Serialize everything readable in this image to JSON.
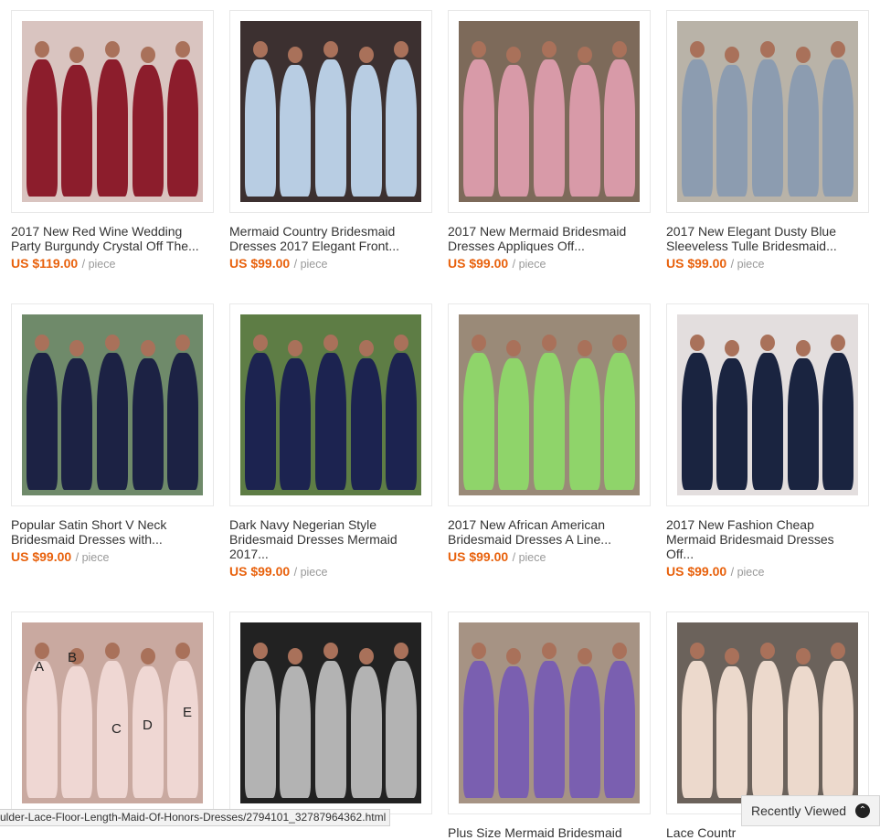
{
  "products": [
    {
      "title": "2017 New Red Wine Wedding\nParty Burgundy Crystal Off The...",
      "price": "US $119.00",
      "unit": "/ piece",
      "bg": "#d9c4c0",
      "dress": "#8c1d2c"
    },
    {
      "title": "Mermaid Country Bridesmaid\nDresses 2017 Elegant Front...",
      "price": "US $99.00",
      "unit": "/ piece",
      "bg": "#3c3030",
      "dress": "#b8cde3"
    },
    {
      "title": "2017 New Mermaid Bridesmaid\nDresses Appliques Off...",
      "price": "US $99.00",
      "unit": "/ piece",
      "bg": "#7d6a5a",
      "dress": "#d89aa8"
    },
    {
      "title": "2017 New Elegant Dusty Blue\nSleeveless Tulle Bridesmaid...",
      "price": "US $99.00",
      "unit": "/ piece",
      "bg": "#b9b3a8",
      "dress": "#8c9cb0"
    },
    {
      "title": "Popular Satin Short V Neck\nBridesmaid Dresses with...",
      "price": "US $99.00",
      "unit": "/ piece",
      "bg": "#6f8a6a",
      "dress": "#1c2244"
    },
    {
      "title": "Dark Navy Negerian Style\nBridesmaid Dresses Mermaid\n2017...",
      "price": "US $99.00",
      "unit": "/ piece",
      "bg": "#5e7d45",
      "dress": "#1c2350"
    },
    {
      "title": "2017 New African American\nBridesmaid Dresses A Line...",
      "price": "US $99.00",
      "unit": "/ piece",
      "bg": "#9a8a78",
      "dress": "#8fd46a"
    },
    {
      "title": "2017 New Fashion Cheap\nMermaid Bridesmaid Dresses\nOff...",
      "price": "US $99.00",
      "unit": "/ piece",
      "bg": "#e3dede",
      "dress": "#1a2440"
    },
    {
      "title": "",
      "price": "",
      "unit": "",
      "bg": "#c9a9a0",
      "dress": "#efd7d3",
      "letters": [
        "A",
        "B",
        "C",
        "D",
        "E"
      ]
    },
    {
      "title": "",
      "price": "",
      "unit": "",
      "bg": "#222222",
      "dress": "#b3b3b3"
    },
    {
      "title": "Plus Size Mermaid Bridesmaid",
      "price": "",
      "unit": "",
      "bg": "#a69384",
      "dress": "#7a5fb0"
    },
    {
      "title": "Lace Countr",
      "price": "",
      "unit": "",
      "bg": "#6b625b",
      "dress": "#ecd9cc"
    }
  ],
  "status_bar": {
    "url": "ulder-Lace-Floor-Length-Maid-Of-Honors-Dresses/2794101_32787964362.html"
  },
  "recently_viewed": {
    "label": "Recently Viewed",
    "icon": "chevron-up-circle-icon"
  }
}
